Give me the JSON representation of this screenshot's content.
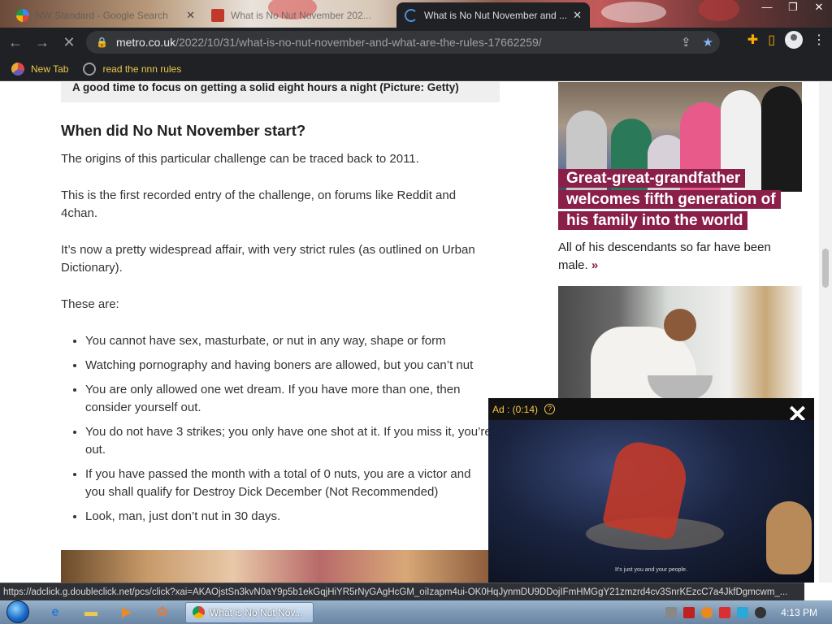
{
  "browser": {
    "tabs": [
      {
        "title": "NW Standard - Google Search",
        "active": false
      },
      {
        "title": "What is No Nut November 202...",
        "active": false
      },
      {
        "title": "What is No Nut November and ...",
        "active": true
      }
    ],
    "url_host": "metro.co.uk",
    "url_path": "/2022/10/31/what-is-no-nut-november-and-what-are-the-rules-17662259/",
    "bookmarks": [
      {
        "label": "New Tab"
      },
      {
        "label": "read the nnn rules"
      }
    ]
  },
  "article": {
    "caption": "A good time to focus on getting a solid eight hours a night (Picture: Getty)",
    "heading": "When did No Nut November start?",
    "paragraphs": [
      "The origins of this particular challenge can be traced back to 2011.",
      "This is the first recorded entry of the challenge, on forums like Reddit and 4chan.",
      "It’s now a pretty widespread affair, with very strict rules (as outlined on Urban Dictionary).",
      "These are:"
    ],
    "rules": [
      "You cannot have sex, masturbate, or nut in any way, shape or form",
      "Watching pornography and having boners are allowed, but you can’t nut",
      "You are only allowed one wet dream. If you have more than one, then consider yourself out.",
      "You do not have 3 strikes; you only have one shot at it. If you miss it, you’re out.",
      "If you have passed the month with a total of 0 nuts, you are a victor and you shall qualify for Destroy Dick December (Not Recommended)",
      "Look, man, just don’t nut in 30 days."
    ]
  },
  "sidebar": {
    "headline": "Great-great-grandfather welcomes fifth generation of his family into the world",
    "teaser": "All of his descendants so far have been male.",
    "more": "»"
  },
  "ad": {
    "label": "Ad : (0:14)",
    "help": "?",
    "close": "✕",
    "subtitle": "It's just you and your people."
  },
  "statusbar": {
    "url": "https://adclick.g.doubleclick.net/pcs/click?xai=AKAOjstSn3kvN0aY9p5b1ekGqjHiYR5rNyGAgHcGM_oiIzapm4ui-OK0HqJynmDU9DDojIFmHMGgY21zmzrd4cv3SnrKEzcC7a4JkfDgmcwm_..."
  },
  "taskbar": {
    "task_label": "What is No Nut Nov...",
    "clock": "4:13 PM"
  },
  "colors": {
    "accent": "#8a1f4a",
    "chrome_dark": "#202124",
    "ad_label": "#f9c64a"
  }
}
